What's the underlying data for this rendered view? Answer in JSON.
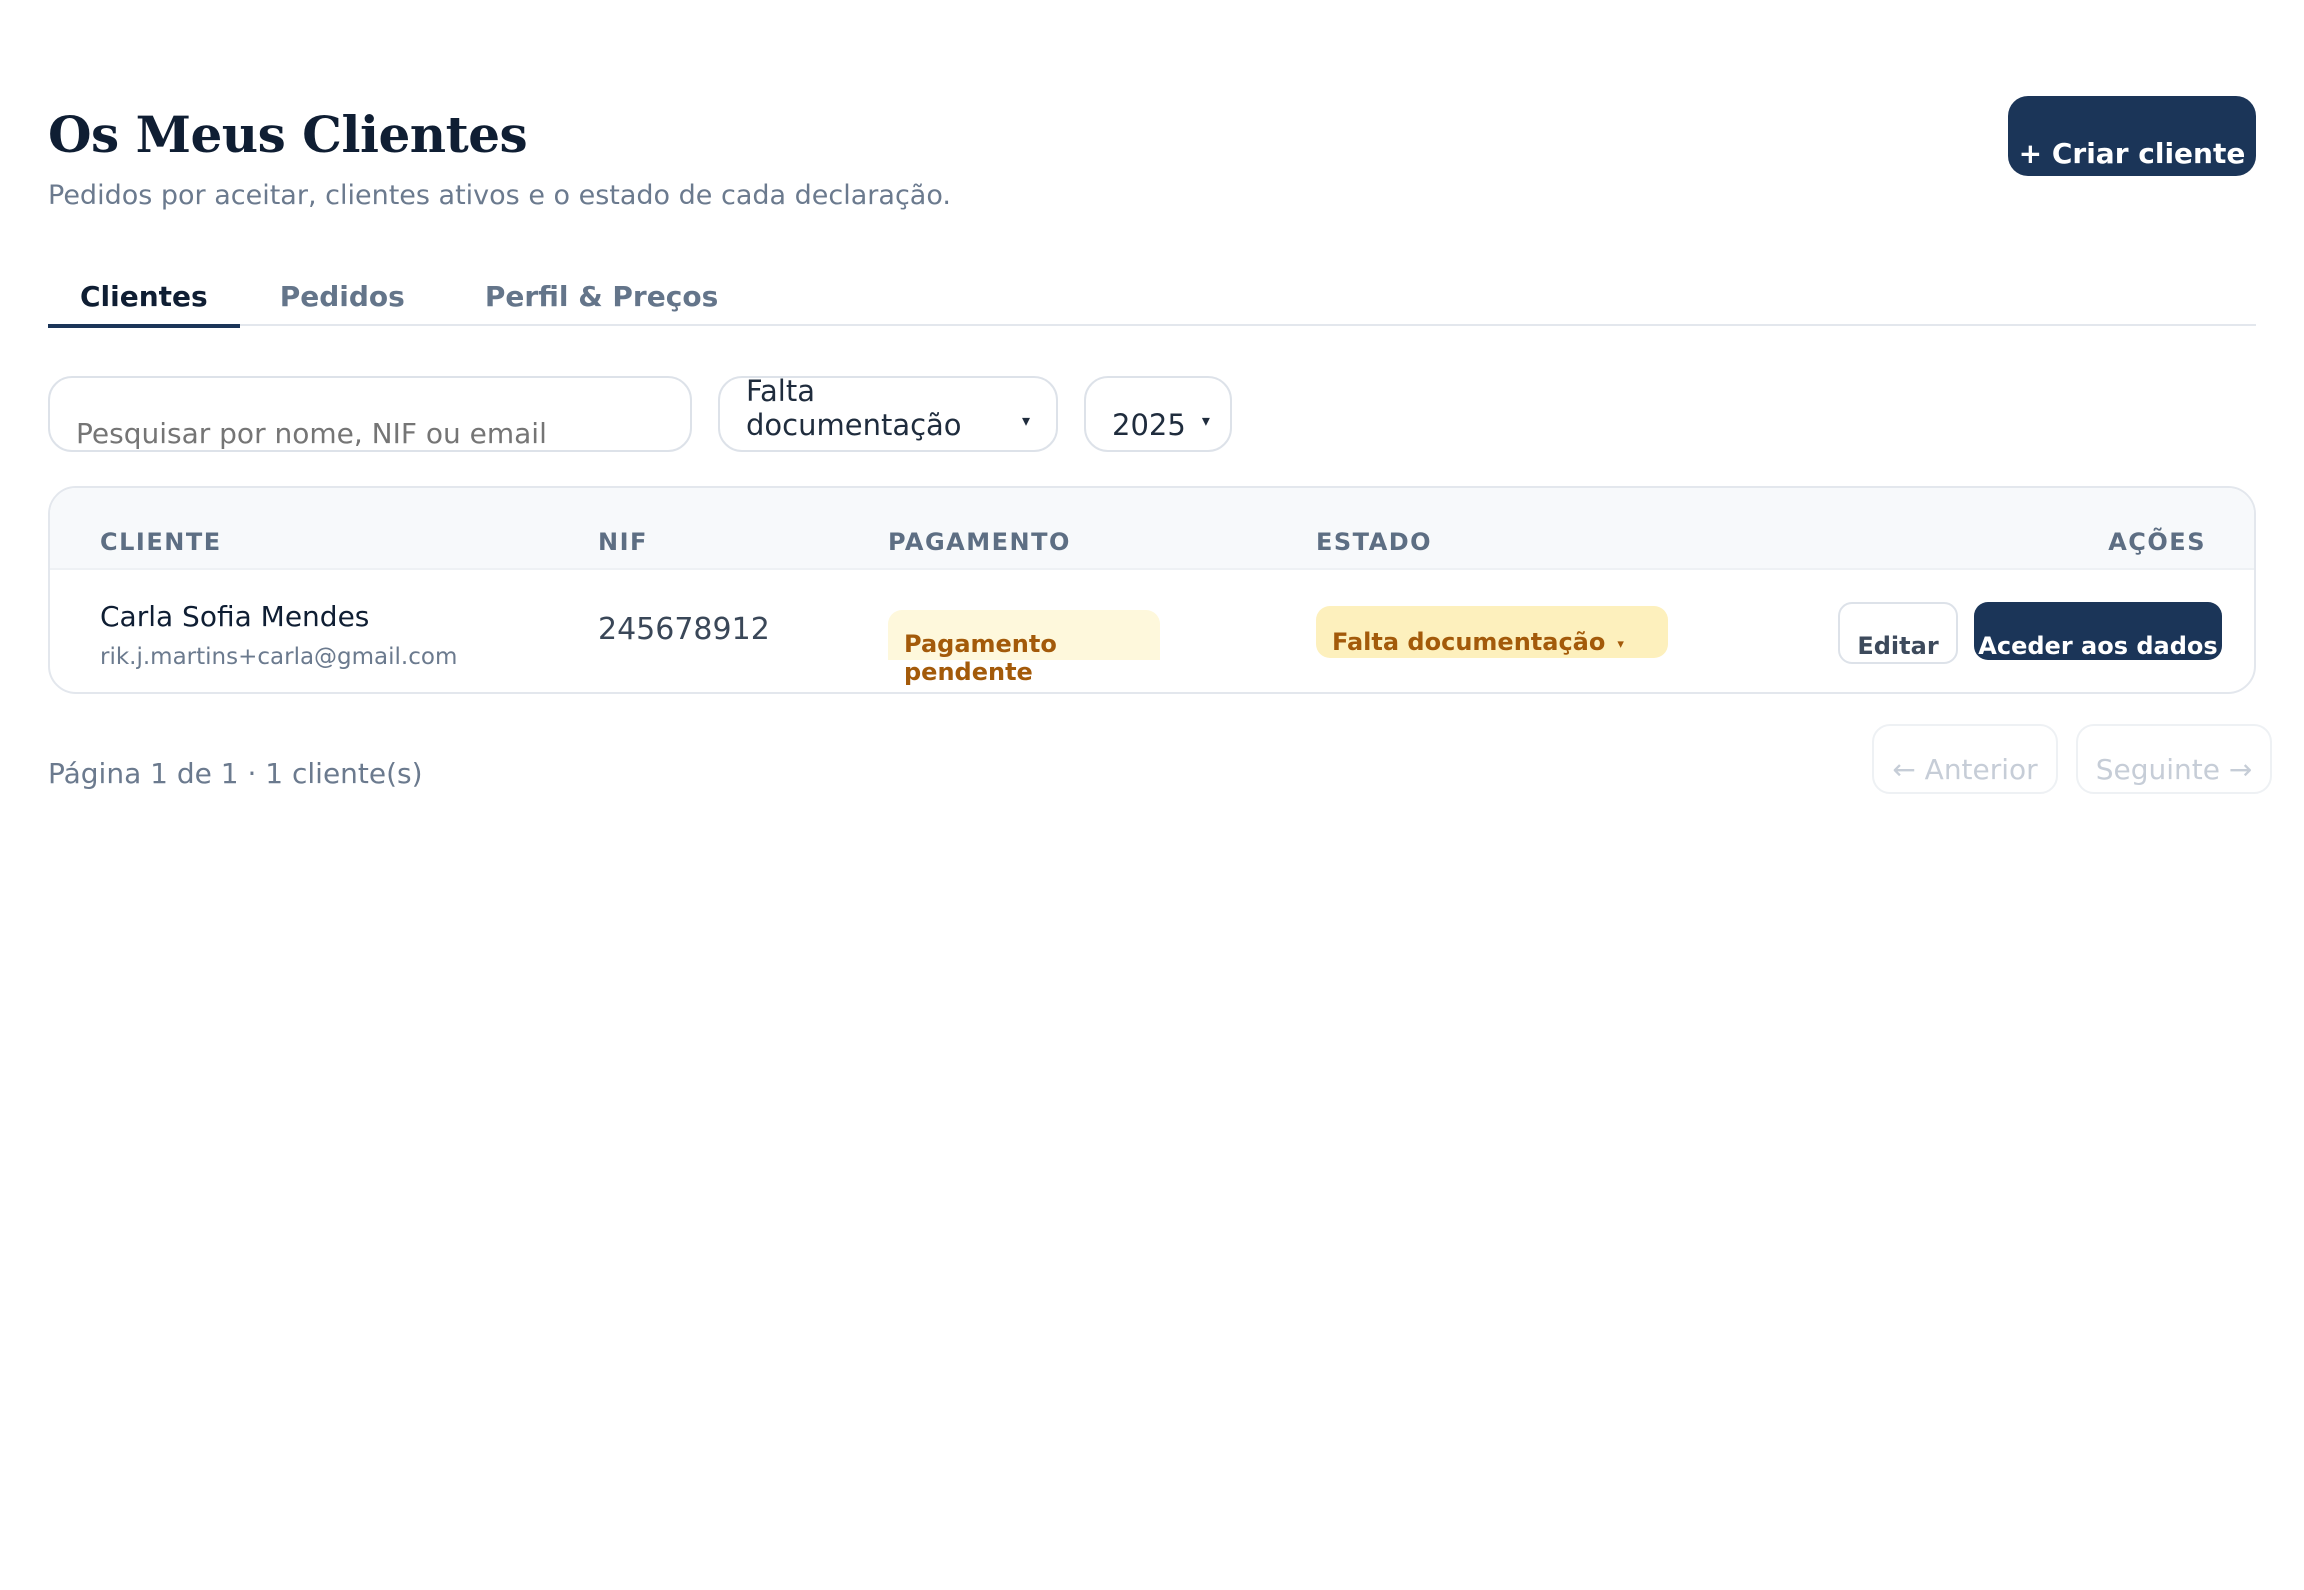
{
  "header": {
    "title": "Os Meus Clientes",
    "subtitle": "Pedidos por aceitar, clientes ativos e o estado de cada declaração.",
    "create_button": "+ Criar cliente"
  },
  "tabs": [
    {
      "label": "Clientes",
      "active": true
    },
    {
      "label": "Pedidos",
      "active": false
    },
    {
      "label": "Perfil & Preços",
      "active": false
    }
  ],
  "filters": {
    "search_placeholder": "Pesquisar por nome, NIF ou email",
    "search_value": "",
    "status_selected": "Falta documentação",
    "year_selected": "2025",
    "caret": "▾"
  },
  "table": {
    "columns": [
      "CLIENTE",
      "NIF",
      "PAGAMENTO",
      "ESTADO",
      "AÇÕES"
    ],
    "rows": [
      {
        "name": "Carla Sofia Mendes",
        "email": "rik.j.martins+carla@gmail.com",
        "nif": "245678912",
        "payment": "Pagamento pendente",
        "status": "Falta documentação",
        "edit_label": "Editar",
        "access_label": "Aceder aos dados"
      }
    ]
  },
  "pagination": {
    "info": "Página 1 de 1 · 1 cliente(s)",
    "prev_label": "← Anterior",
    "next_label": "Seguinte →"
  },
  "colors": {
    "primary": "#1b3558",
    "payment_badge_bg": "#fef8dc",
    "status_badge_bg": "#fdf0bd",
    "badge_text": "#a35a0a"
  }
}
